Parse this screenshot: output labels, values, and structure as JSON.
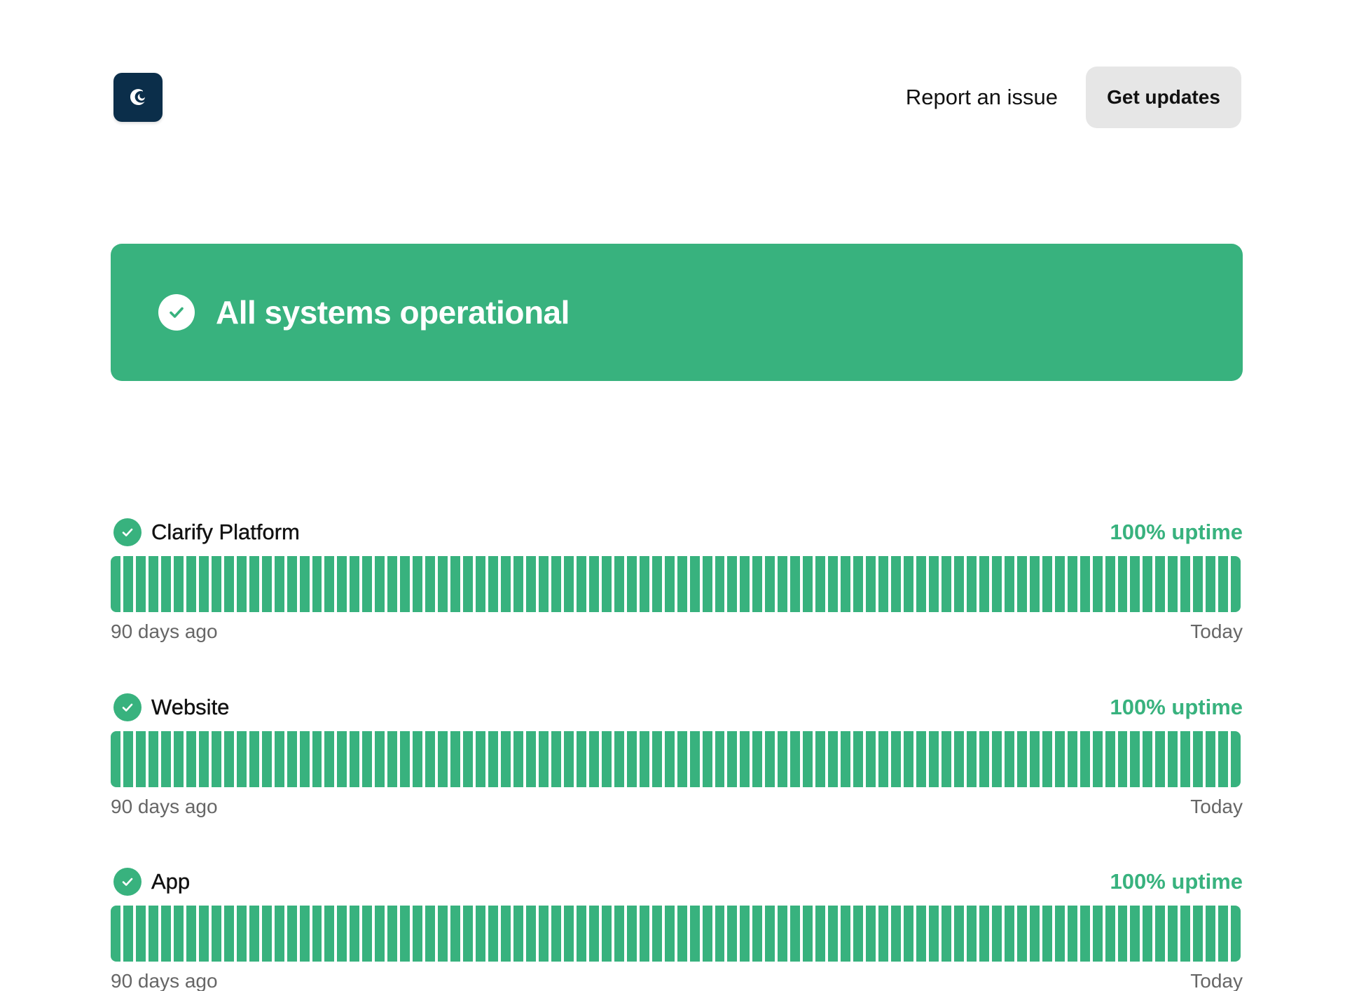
{
  "header": {
    "logo_icon": "clarify-logo-icon",
    "report_label": "Report an issue",
    "updates_label": "Get updates"
  },
  "banner": {
    "icon": "check-circle-icon",
    "title": "All systems operational",
    "color": "#38b27e"
  },
  "components": [
    {
      "name": "Clarify Platform",
      "uptime": "100% uptime",
      "start_label": "90 days ago",
      "end_label": "Today",
      "status_color": "#38b27e",
      "days": 90,
      "uptime_fraction": 1.0
    },
    {
      "name": "Website",
      "uptime": "100% uptime",
      "start_label": "90 days ago",
      "end_label": "Today",
      "status_color": "#38b27e",
      "days": 90,
      "uptime_fraction": 1.0
    },
    {
      "name": "App",
      "uptime": "100% uptime",
      "start_label": "90 days ago",
      "end_label": "Today",
      "status_color": "#38b27e",
      "days": 90,
      "uptime_fraction": 1.0
    }
  ]
}
